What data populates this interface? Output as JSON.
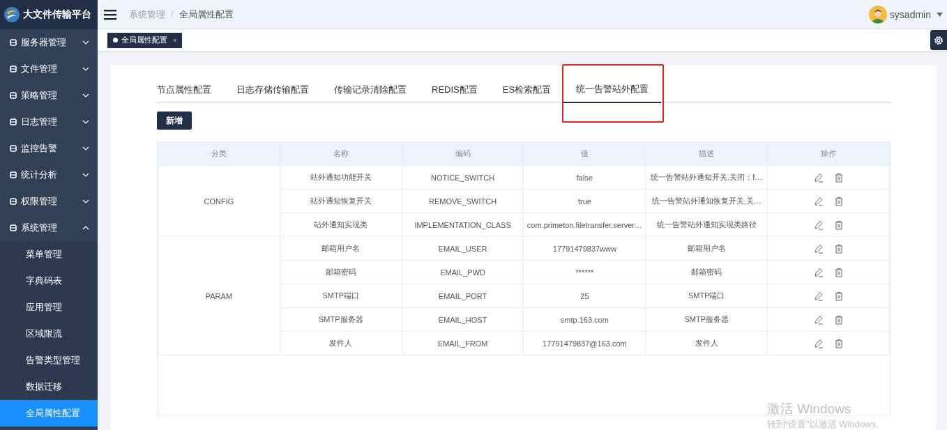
{
  "app": {
    "title": "大文件传输平台"
  },
  "sidebar": {
    "items": [
      {
        "label": "服务器管理",
        "expanded": false
      },
      {
        "label": "文件管理",
        "expanded": false
      },
      {
        "label": "策略管理",
        "expanded": false
      },
      {
        "label": "日志管理",
        "expanded": false
      },
      {
        "label": "监控告警",
        "expanded": false
      },
      {
        "label": "统计分析",
        "expanded": false
      },
      {
        "label": "权限管理",
        "expanded": false
      },
      {
        "label": "系统管理",
        "expanded": true,
        "children": [
          {
            "label": "菜单管理",
            "selected": false
          },
          {
            "label": "字典码表",
            "selected": false
          },
          {
            "label": "应用管理",
            "selected": false
          },
          {
            "label": "区域限流",
            "selected": false
          },
          {
            "label": "告警类型管理",
            "selected": false
          },
          {
            "label": "数据迁移",
            "selected": false
          },
          {
            "label": "全局属性配置",
            "selected": true
          }
        ]
      }
    ]
  },
  "breadcrumb": [
    {
      "label": "系统管理"
    },
    {
      "label": "全局属性配置"
    }
  ],
  "breadcrumb_separator": "/",
  "user": {
    "name": "sysadmin"
  },
  "open_tabs": [
    {
      "label": "全局属性配置",
      "selected": true,
      "close": "×"
    }
  ],
  "config_tabs": [
    {
      "label": "节点属性配置",
      "selected": false,
      "highlighted": false
    },
    {
      "label": "日志存储传输配置",
      "selected": false,
      "highlighted": false
    },
    {
      "label": "传输记录清除配置",
      "selected": false,
      "highlighted": false
    },
    {
      "label": "REDIS配置",
      "selected": false,
      "highlighted": false
    },
    {
      "label": "ES检索配置",
      "selected": false,
      "highlighted": false
    },
    {
      "label": "统一告警站外配置",
      "selected": true,
      "highlighted": true
    }
  ],
  "add_button": "新增",
  "table": {
    "columns": [
      "分类",
      "名称",
      "编码",
      "值",
      "描述",
      "操作"
    ],
    "groups": [
      {
        "category": "CONFIG",
        "rows": [
          {
            "name": "站外通知功能开关",
            "code": "NOTICE_SWITCH",
            "value": "false",
            "description": "统一告警站外通知开关,关闭：f…"
          },
          {
            "name": "站外通知恢复开关",
            "code": "REMOVE_SWITCH",
            "value": "true",
            "description": "统一告警站外通知恢复开关,关…"
          },
          {
            "name": "站外通知实现类",
            "code": "IMPLEMENTATION_CLASS",
            "value": "com.primeton.filetransfer.server…",
            "description": "统一告警站外通知实现类路径"
          }
        ]
      },
      {
        "category": "PARAM",
        "rows": [
          {
            "name": "邮箱用户名",
            "code": "EMAIL_USER",
            "value": "17791479837www",
            "description": "邮箱用户名"
          },
          {
            "name": "邮箱密码",
            "code": "EMAIL_PWD",
            "value": "******",
            "description": "邮箱密码"
          },
          {
            "name": "SMTP端口",
            "code": "EMAIL_PORT",
            "value": "25",
            "description": "SMTP端口"
          },
          {
            "name": "SMTP服务器",
            "code": "EMAIL_HOST",
            "value": "smtp.163.com",
            "description": "SMTP服务器"
          },
          {
            "name": "发件人",
            "code": "EMAIL_FROM",
            "value": "17791479837@163.com",
            "description": "发件人"
          }
        ]
      }
    ]
  },
  "os_notice": {
    "title": "激活 Windows",
    "subtitle": "转到“设置”以激活 Windows。"
  }
}
